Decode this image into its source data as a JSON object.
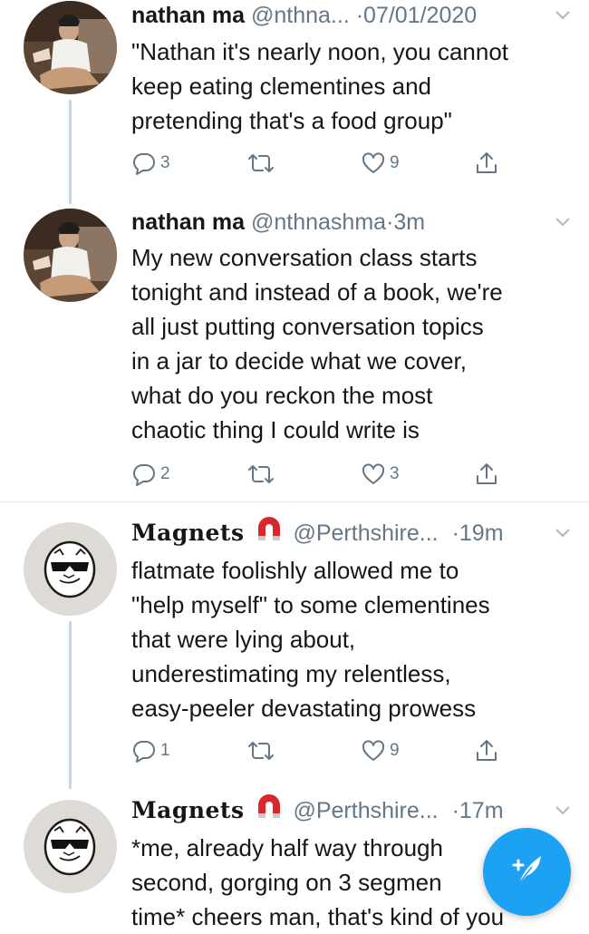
{
  "tweets": [
    {
      "name": "nathan ma",
      "handle": "@nthna...",
      "sep": "·",
      "time": "07/01/2020",
      "lines": [
        "\"Nathan it's nearly noon, you cannot",
        "keep eating clementines and",
        "pretending that's a food group\""
      ],
      "replies": "3",
      "retweets": "",
      "likes": "9"
    },
    {
      "name": "nathan ma",
      "handle": "@nthnashma",
      "sep": "·",
      "time": "3m",
      "lines": [
        "My new conversation class starts",
        "tonight and instead of a book, we're",
        "all just putting conversation topics",
        "in a jar to decide what we cover,",
        "what do you reckon the most",
        "chaotic thing I could write is"
      ],
      "replies": "2",
      "retweets": "",
      "likes": "3"
    },
    {
      "name": "Magnets",
      "handle": "@Perthshire...",
      "sep": "·",
      "time": "19m",
      "lines": [
        "flatmate foolishly allowed me to",
        "\"help myself\" to some clementines",
        "that were lying about,",
        "underestimating my relentless,",
        "easy-peeler devastating prowess"
      ],
      "replies": "1",
      "retweets": "",
      "likes": "9"
    },
    {
      "name": "Magnets",
      "handle": "@Perthshire...",
      "sep": "·",
      "time": "17m",
      "lines": [
        "*me, already half way through",
        "second, gorging on 3 segmen",
        "time* cheers man, that's kind of you"
      ]
    }
  ],
  "icons": {
    "reply": "reply-icon",
    "retweet": "retweet-icon",
    "like": "heart-icon",
    "share": "share-icon",
    "chevron": "chevron-down-icon",
    "magnet": "magnet-emoji-icon",
    "compose": "compose-tweet-icon"
  },
  "colors": {
    "accent": "#1da1f2",
    "text": "#14171a",
    "muted": "#657786",
    "thread_line": "#ccd6dd",
    "magnet_red": "#d9272e"
  }
}
